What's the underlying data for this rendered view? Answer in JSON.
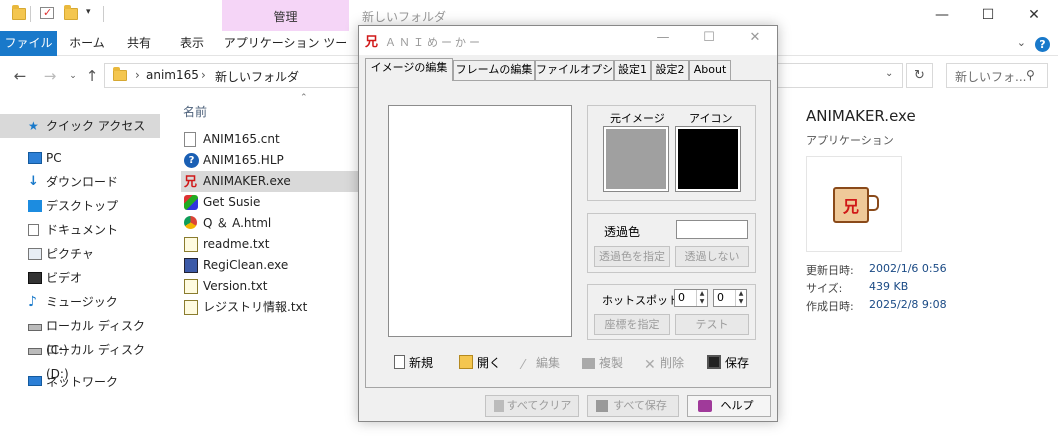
{
  "explorer": {
    "context_tab": "管理",
    "window_title": "新しいフォルダ",
    "ribbon_tabs": [
      "ファイル",
      "ホーム",
      "共有",
      "表示",
      "アプリケーション ツール"
    ],
    "address": [
      "anim165",
      "新しいフォルダ"
    ],
    "search_placeholder": "新しいフォ...",
    "nav": [
      {
        "label": "クイック アクセス",
        "icon": "star-icon",
        "selected": true
      },
      {
        "label": "PC",
        "icon": "pc-icon"
      },
      {
        "label": "ダウンロード",
        "icon": "download-icon"
      },
      {
        "label": "デスクトップ",
        "icon": "desktop-icon"
      },
      {
        "label": "ドキュメント",
        "icon": "document-icon"
      },
      {
        "label": "ピクチャ",
        "icon": "pictures-icon"
      },
      {
        "label": "ビデオ",
        "icon": "video-icon"
      },
      {
        "label": "ミュージック",
        "icon": "music-icon"
      },
      {
        "label": "ローカル ディスク (C:)",
        "icon": "drive-icon"
      },
      {
        "label": "ローカル ディスク (D:)",
        "icon": "drive-icon"
      },
      {
        "label": "ネットワーク",
        "icon": "network-icon"
      }
    ],
    "column_header": "名前",
    "files": [
      {
        "name": "ANIM165.cnt",
        "icon": "file-icon"
      },
      {
        "name": "ANIM165.HLP",
        "icon": "help-file-icon"
      },
      {
        "name": "ANIMAKER.exe",
        "icon": "app-icon",
        "selected": true
      },
      {
        "name": "Get Susie",
        "icon": "shortcut-icon"
      },
      {
        "name": "Q ＆ A.html",
        "icon": "chrome-html-icon"
      },
      {
        "name": "readme.txt",
        "icon": "text-file-icon"
      },
      {
        "name": "RegiClean.exe",
        "icon": "regiclean-icon"
      },
      {
        "name": "Version.txt",
        "icon": "text-file-icon"
      },
      {
        "name": "レジストリ情報.txt",
        "icon": "text-file-icon"
      }
    ],
    "details": {
      "name": "ANIMAKER.exe",
      "type": "アプリケーション",
      "rows": [
        {
          "key": "更新日時:",
          "value": "2002/1/6 0:56"
        },
        {
          "key": "サイズ:",
          "value": "439 KB"
        },
        {
          "key": "作成日時:",
          "value": "2025/2/8 9:08"
        }
      ]
    }
  },
  "dialog": {
    "title": "ＡＮＩめーかー",
    "tabs": [
      "イメージの編集",
      "フレームの編集",
      "ファイルオプション",
      "設定1",
      "設定2",
      "About"
    ],
    "original_label": "元イメージ",
    "icon_label": "アイコン",
    "transparent_label": "透過色",
    "transparent_value": "",
    "btn_set_transparent": "透過色を指定",
    "btn_no_transparent": "透過しない",
    "hotspot_label": "ホットスポット",
    "hotspot_x": "0",
    "hotspot_y": "0",
    "btn_set_coord": "座標を指定",
    "btn_test": "テスト",
    "toolbar": {
      "new": "新規",
      "open": "開く",
      "edit": "編集",
      "copy": "複製",
      "delete": "削除",
      "save": "保存"
    },
    "bottom": {
      "clear_all": "すべてクリア",
      "save_all": "すべて保存",
      "help": "ヘルプ"
    }
  },
  "colors": {
    "accent": "#1979ca",
    "context_tab": "#f5d5f7",
    "swatch_original": "#a0a0a0",
    "swatch_icon": "#000000"
  }
}
